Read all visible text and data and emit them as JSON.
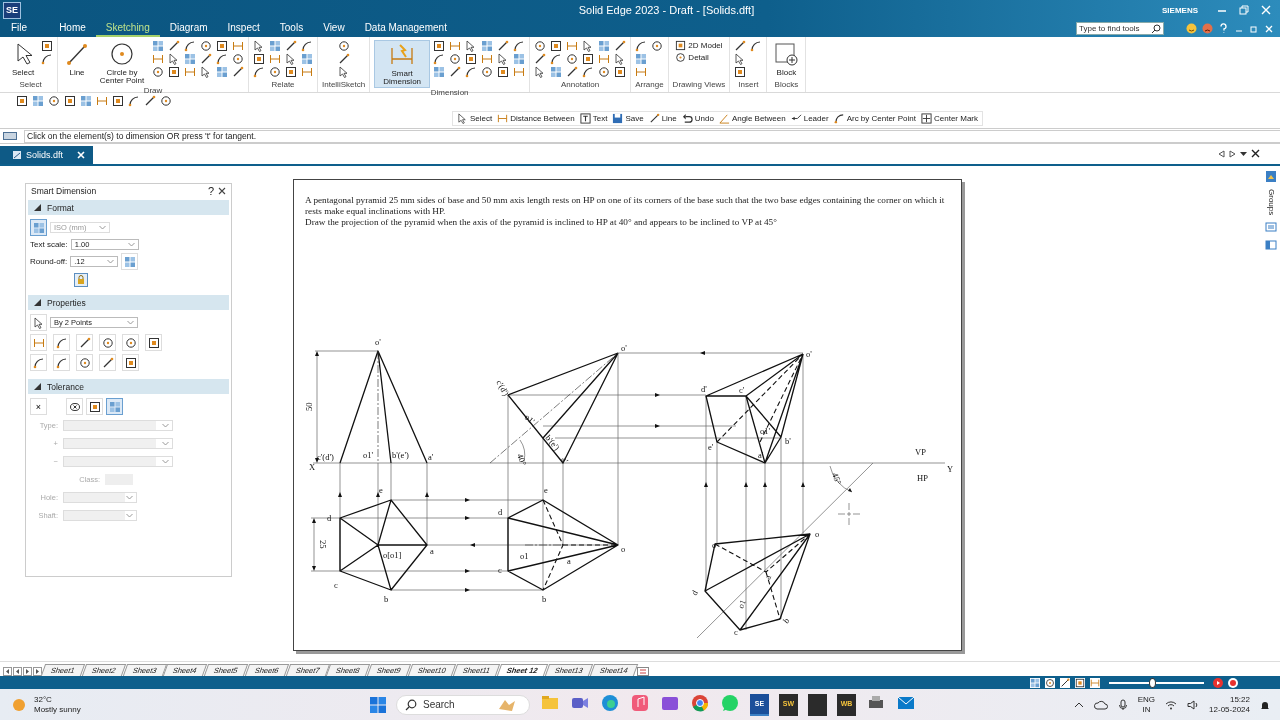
{
  "window": {
    "app_badge": "SE",
    "title": "Solid Edge 2023 - Draft - [Solids.dft]",
    "brand": "SIEMENS"
  },
  "menu_tabs": [
    {
      "label": "File",
      "selected": false
    },
    {
      "label": "Home",
      "selected": false
    },
    {
      "label": "Sketching",
      "selected": true
    },
    {
      "label": "Diagram",
      "selected": false
    },
    {
      "label": "Inspect",
      "selected": false
    },
    {
      "label": "Tools",
      "selected": false
    },
    {
      "label": "View",
      "selected": false
    },
    {
      "label": "Data Management",
      "selected": false
    }
  ],
  "search": {
    "placeholder": "Type to find tools"
  },
  "ribbon_groups": [
    {
      "label": "Select",
      "buttons": [
        {
          "label": "Select",
          "kind": "large",
          "selected": false
        }
      ]
    },
    {
      "label": "Draw",
      "buttons": [
        {
          "label": "Line",
          "kind": "large",
          "selected": false
        },
        {
          "label": "Circle by Center Point",
          "kind": "large",
          "selected": false
        }
      ]
    },
    {
      "label": "Relate"
    },
    {
      "label": "IntelliSketch"
    },
    {
      "label": "Dimension",
      "buttons": [
        {
          "label": "Smart Dimension",
          "kind": "large",
          "selected": true
        }
      ]
    },
    {
      "label": "Annotation"
    },
    {
      "label": "Arrange"
    },
    {
      "label": "Drawing Views",
      "buttons": [
        {
          "label": "2D Model",
          "kind": "small",
          "selected": false
        },
        {
          "label": "Detail",
          "kind": "small",
          "selected": false
        }
      ]
    },
    {
      "label": "Insert"
    },
    {
      "label": "Blocks",
      "buttons": [
        {
          "label": "Block",
          "kind": "large",
          "selected": false
        }
      ]
    }
  ],
  "command_bar": [
    "Select",
    "Distance Between",
    "Text",
    "Save",
    "Line",
    "Undo",
    "Angle Between",
    "Leader",
    "Arc by Center Point",
    "Center Mark"
  ],
  "prompt": "Click on the element(s) to dimension OR press 't' for tangent.",
  "document_tabs": [
    {
      "label": "Solids.dft",
      "selected": true
    }
  ],
  "panel": {
    "title": "Smart Dimension",
    "help": "?",
    "format": {
      "title": "Format",
      "expanded": true,
      "standard": {
        "value": "ISO (mm)",
        "disabled": true
      },
      "fields": [
        {
          "label": "Text scale:",
          "value": "1.00"
        },
        {
          "label": "Round-off:",
          "value": ".12"
        }
      ]
    },
    "properties": {
      "title": "Properties",
      "expanded": true,
      "method": "By 2 Points"
    },
    "tolerance": {
      "title": "Tolerance",
      "expanded": true,
      "clear_label": "×",
      "fields": [
        {
          "label": "Type:",
          "kind": "dropdown",
          "disabled": true
        },
        {
          "label": "+",
          "kind": "dropdown",
          "disabled": true
        },
        {
          "label": "−",
          "kind": "dropdown",
          "disabled": true
        },
        {
          "label": "Class:",
          "kind": "box",
          "disabled": true
        },
        {
          "label": "Hole:",
          "kind": "dropdown",
          "disabled": true
        },
        {
          "label": "Shaft:",
          "kind": "dropdown",
          "disabled": true
        }
      ]
    }
  },
  "sheet": {
    "statement": [
      "A pentagonal pyramid 25 mm sides of base and 50 mm axis length rests on HP on one of its corners of the base such that the two base edges containing the corner on which it rests make equal inclinations with HP.",
      "Draw the projection of the pyramid when the axis of the pyramid is inclined to HP at 40° and appears to be inclined to VP at 45°"
    ],
    "labels": [
      "o'",
      "50",
      "c'(d')",
      "o1'",
      "b'(e')",
      "a'",
      "X",
      "e",
      "d",
      "25",
      "o[o1]",
      "a",
      "c",
      "b",
      "o'",
      "c'(d')",
      "o1'",
      "b'(e')",
      "40°",
      "a'",
      "e",
      "d",
      "o1",
      "a",
      "o",
      "c",
      "b",
      "d'",
      "c'",
      "o'",
      "o1'",
      "b'",
      "e'",
      "a'",
      "VP",
      "Y",
      "HP",
      "45°",
      "o",
      "o",
      "d",
      "o1",
      "a",
      "c",
      "b"
    ]
  },
  "side_strip": {
    "label": "Groups"
  },
  "sheet_tabs": [
    {
      "label": "Sheet1",
      "selected": false
    },
    {
      "label": "Sheet2",
      "selected": false
    },
    {
      "label": "Sheet3",
      "selected": false
    },
    {
      "label": "Sheet4",
      "selected": false
    },
    {
      "label": "Sheet5",
      "selected": false
    },
    {
      "label": "Sheet6",
      "selected": false
    },
    {
      "label": "Sheet7",
      "selected": false
    },
    {
      "label": "Sheet8",
      "selected": false
    },
    {
      "label": "Sheet9",
      "selected": false
    },
    {
      "label": "Sheet10",
      "selected": false
    },
    {
      "label": "Sheet11",
      "selected": false
    },
    {
      "label": "Sheet 12",
      "selected": true
    },
    {
      "label": "Sheet13",
      "selected": false
    },
    {
      "label": "Sheet14",
      "selected": false
    }
  ],
  "zoom_slider": {
    "level": 0.45
  },
  "taskbar": {
    "temperature": "32°C",
    "weather": "Mostly sunny",
    "search_placeholder": "Search",
    "apps": [
      {
        "kind": "files",
        "selected": false
      },
      {
        "kind": "meet",
        "selected": false
      },
      {
        "kind": "browser",
        "selected": false
      },
      {
        "kind": "music",
        "selected": false
      },
      {
        "kind": "video",
        "selected": false
      },
      {
        "kind": "chrome",
        "selected": false
      },
      {
        "kind": "chat",
        "selected": false
      },
      {
        "kind": "solidedge",
        "label": "SE",
        "selected": true
      },
      {
        "kind": "tile",
        "label": "SW",
        "selected": false
      },
      {
        "kind": "tile",
        "selected": false
      },
      {
        "kind": "tile",
        "label": "WB",
        "selected": false
      },
      {
        "kind": "printer",
        "selected": false
      },
      {
        "kind": "mail",
        "selected": false
      }
    ],
    "language": "ENG",
    "region": "IN",
    "time": "15:22",
    "date": "12-05-2024"
  }
}
